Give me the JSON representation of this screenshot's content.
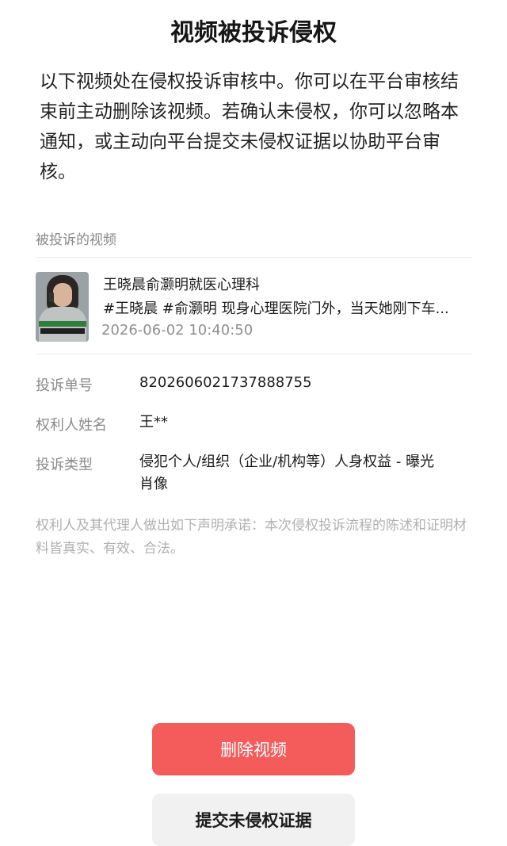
{
  "page": {
    "title": "视频被投诉侵权",
    "intro": "以下视频处在侵权投诉审核中。你可以在平台审核结束前主动删除该视频。若确认未侵权，你可以忽略本通知，或主动向平台提交未侵权证据以协助平台审核。"
  },
  "video_section": {
    "label": "被投诉的视频",
    "video": {
      "thumbnail_icon": "video-thumbnail",
      "title": "王晓晨俞灏明就医心理科",
      "tags_line": "#王晓晨 #俞灏明 现身心理医院门外，当天她刚下车...",
      "time": "2026-06-02 10:40:50"
    }
  },
  "details": [
    {
      "label": "投诉单号",
      "value": "8202606021737888755"
    },
    {
      "label": "权利人姓名",
      "value": "王**"
    },
    {
      "label": "投诉类型",
      "value": "侵犯个人/组织（企业/机构等）人身权益 - 曝光肖像"
    }
  ],
  "statement": "权利人及其代理人做出如下声明承诺：本次侵权投诉流程的陈述和证明材料皆真实、有效、合法。",
  "actions": {
    "delete_label": "删除视频",
    "submit_label": "提交未侵权证据",
    "delete_color": "#f45c5c",
    "submit_color": "#f1f1f1"
  }
}
